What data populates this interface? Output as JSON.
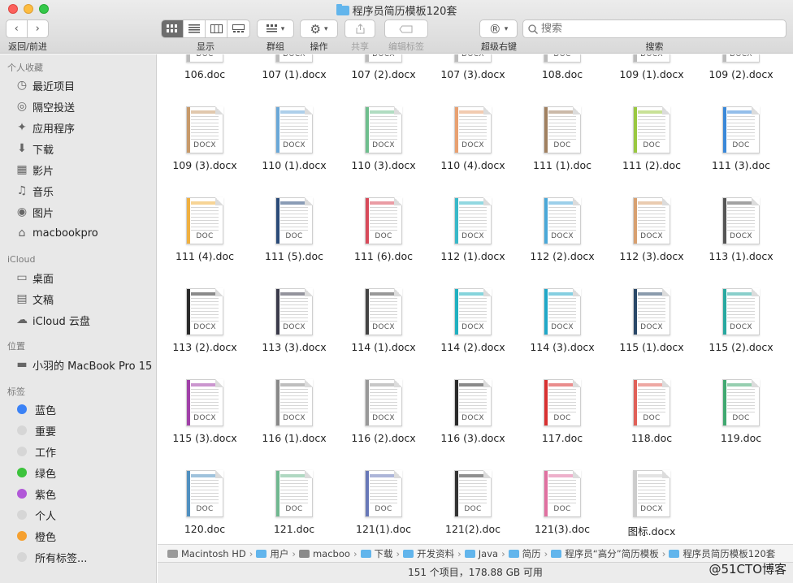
{
  "window": {
    "title": "程序员简历模板120套"
  },
  "toolbar": {
    "nav_label": "返回/前进",
    "view_label": "显示",
    "group_label": "群组",
    "action_label": "操作",
    "share_label": "共享",
    "tags_label": "编辑标签",
    "super_right_label": "超级右键",
    "search_label": "搜索",
    "search_placeholder": "搜索",
    "active_view": "icon"
  },
  "sidebar": {
    "favorites_header": "个人收藏",
    "favorites": [
      {
        "label": "最近项目",
        "icon": "clock-icon"
      },
      {
        "label": "隔空投送",
        "icon": "airdrop-icon"
      },
      {
        "label": "应用程序",
        "icon": "applications-icon"
      },
      {
        "label": "下载",
        "icon": "download-icon"
      },
      {
        "label": "影片",
        "icon": "film-icon"
      },
      {
        "label": "音乐",
        "icon": "music-icon"
      },
      {
        "label": "图片",
        "icon": "camera-icon"
      },
      {
        "label": "macbookpro",
        "icon": "home-icon"
      }
    ],
    "icloud_header": "iCloud",
    "icloud": [
      {
        "label": "桌面",
        "icon": "desktop-icon"
      },
      {
        "label": "文稿",
        "icon": "document-icon"
      },
      {
        "label": "iCloud 云盘",
        "icon": "cloud-icon"
      }
    ],
    "locations_header": "位置",
    "locations": [
      {
        "label": "小羽的 MacBook Pro 15",
        "icon": "laptop-icon"
      }
    ],
    "tags_header": "标签",
    "tags": [
      {
        "label": "蓝色",
        "color": "#3b82f6"
      },
      {
        "label": "重要",
        "color": "#d6d6d6"
      },
      {
        "label": "工作",
        "color": "#d6d6d6"
      },
      {
        "label": "绿色",
        "color": "#3cc33c"
      },
      {
        "label": "紫色",
        "color": "#b158d8"
      },
      {
        "label": "个人",
        "color": "#d6d6d6"
      },
      {
        "label": "橙色",
        "color": "#f5a030"
      },
      {
        "label": "所有标签...",
        "color": "#d6d6d6"
      }
    ]
  },
  "files": [
    {
      "name": "106.doc",
      "ext": "DOC",
      "accent": "#bbbbbb"
    },
    {
      "name": "107 (1).docx",
      "ext": "DOCX",
      "accent": "#bbbbbb"
    },
    {
      "name": "107 (2).docx",
      "ext": "DOCX",
      "accent": "#bbbbbb"
    },
    {
      "name": "107 (3).docx",
      "ext": "DOCX",
      "accent": "#bbbbbb"
    },
    {
      "name": "108.doc",
      "ext": "DOC",
      "accent": "#bbbbbb"
    },
    {
      "name": "109 (1).docx",
      "ext": "DOCX",
      "accent": "#bbbbbb"
    },
    {
      "name": "109 (2).docx",
      "ext": "DOCX",
      "accent": "#bbbbbb"
    },
    {
      "name": "109 (3).docx",
      "ext": "DOCX",
      "accent": "#c89a6a"
    },
    {
      "name": "110 (1).docx",
      "ext": "DOCX",
      "accent": "#6aa8d8"
    },
    {
      "name": "110 (3).docx",
      "ext": "DOCX",
      "accent": "#6fbf8e"
    },
    {
      "name": "110 (4).docx",
      "ext": "DOCX",
      "accent": "#e8a070"
    },
    {
      "name": "111 (1).doc",
      "ext": "DOC",
      "accent": "#a08060"
    },
    {
      "name": "111 (2).doc",
      "ext": "DOC",
      "accent": "#9ac840"
    },
    {
      "name": "111 (3).doc",
      "ext": "DOC",
      "accent": "#3a88d8"
    },
    {
      "name": "111 (4).doc",
      "ext": "DOC",
      "accent": "#f0b040"
    },
    {
      "name": "111 (5).doc",
      "ext": "DOC",
      "accent": "#2a4a78"
    },
    {
      "name": "111 (6).doc",
      "ext": "DOC",
      "accent": "#d84a5a"
    },
    {
      "name": "112 (1).docx",
      "ext": "DOCX",
      "accent": "#38b8c8"
    },
    {
      "name": "112 (2).docx",
      "ext": "DOCX",
      "accent": "#4aa8d8"
    },
    {
      "name": "112 (3).docx",
      "ext": "DOCX",
      "accent": "#d8a070"
    },
    {
      "name": "113 (1).docx",
      "ext": "DOCX",
      "accent": "#555555"
    },
    {
      "name": "113 (2).docx",
      "ext": "DOCX",
      "accent": "#2a2a2a"
    },
    {
      "name": "113 (3).docx",
      "ext": "DOCX",
      "accent": "#3a3a4a"
    },
    {
      "name": "114 (1).docx",
      "ext": "DOCX",
      "accent": "#444444"
    },
    {
      "name": "114 (2).docx",
      "ext": "DOCX",
      "accent": "#20b0c0"
    },
    {
      "name": "114 (3).docx",
      "ext": "DOCX",
      "accent": "#20a8c8"
    },
    {
      "name": "115 (1).docx",
      "ext": "DOCX",
      "accent": "#2a4868"
    },
    {
      "name": "115 (2).docx",
      "ext": "DOCX",
      "accent": "#28a8a0"
    },
    {
      "name": "115 (3).docx",
      "ext": "DOCX",
      "accent": "#a040a8"
    },
    {
      "name": "116 (1).docx",
      "ext": "DOCX",
      "accent": "#888888"
    },
    {
      "name": "116 (2).docx",
      "ext": "DOCX",
      "accent": "#999999"
    },
    {
      "name": "116 (3).docx",
      "ext": "DOCX",
      "accent": "#2a2a2a"
    },
    {
      "name": "117.doc",
      "ext": "DOC",
      "accent": "#d83030"
    },
    {
      "name": "118.doc",
      "ext": "DOC",
      "accent": "#e06058"
    },
    {
      "name": "119.doc",
      "ext": "DOC",
      "accent": "#40a870"
    },
    {
      "name": "120.doc",
      "ext": "DOC",
      "accent": "#5090c0"
    },
    {
      "name": "121.doc",
      "ext": "DOC",
      "accent": "#70b890"
    },
    {
      "name": "121(1).doc",
      "ext": "DOC",
      "accent": "#6878b8"
    },
    {
      "name": "121(2).doc",
      "ext": "DOC",
      "accent": "#333333"
    },
    {
      "name": "121(3).doc",
      "ext": "DOC",
      "accent": "#e070a0"
    },
    {
      "name": "图标.docx",
      "ext": "DOCX",
      "accent": "#cccccc"
    }
  ],
  "pathbar": [
    {
      "label": "Macintosh HD",
      "kind": "hd"
    },
    {
      "label": "用户",
      "kind": "folder"
    },
    {
      "label": "macboo",
      "kind": "home"
    },
    {
      "label": "下载",
      "kind": "folder"
    },
    {
      "label": "开发资料",
      "kind": "folder"
    },
    {
      "label": "Java",
      "kind": "folder"
    },
    {
      "label": "简历",
      "kind": "folder"
    },
    {
      "label": "程序员“高分”简历模板",
      "kind": "folder"
    },
    {
      "label": "程序员简历模板120套",
      "kind": "folder"
    }
  ],
  "status": {
    "text": "151 个项目，178.88 GB 可用"
  },
  "watermark": "@51CTO博客"
}
